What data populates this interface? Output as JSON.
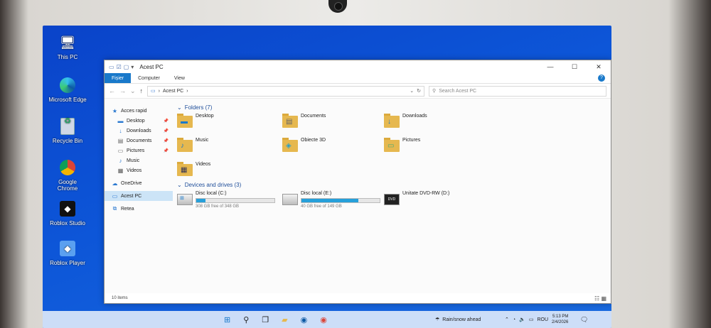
{
  "desktop": {
    "icons": [
      {
        "label": "This PC",
        "icon": "monitor-icon"
      },
      {
        "label": "Microsoft Edge",
        "icon": "edge-icon"
      },
      {
        "label": "Recycle Bin",
        "icon": "recycle-bin-icon"
      },
      {
        "label": "Google Chrome",
        "icon": "chrome-icon"
      },
      {
        "label": "Roblox Studio",
        "icon": "roblox-studio-icon"
      },
      {
        "label": "Roblox Player",
        "icon": "roblox-player-icon"
      }
    ]
  },
  "window": {
    "title": "Acest PC",
    "ribbon_tabs": [
      "Fișier",
      "Computer",
      "View"
    ],
    "address": {
      "path_root": "Acest PC",
      "path_sep": "›",
      "search_placeholder": "Search Acest PC"
    },
    "sidebar": {
      "items": [
        {
          "label": "Acces rapid",
          "icon": "star-icon",
          "pinned": false
        },
        {
          "label": "Desktop",
          "icon": "desktop-folder-icon",
          "pinned": true
        },
        {
          "label": "Downloads",
          "icon": "download-icon",
          "pinned": true
        },
        {
          "label": "Documents",
          "icon": "documents-icon",
          "pinned": true
        },
        {
          "label": "Pictures",
          "icon": "pictures-icon",
          "pinned": true
        },
        {
          "label": "Music",
          "icon": "music-icon",
          "pinned": false
        },
        {
          "label": "Videos",
          "icon": "videos-icon",
          "pinned": false
        },
        {
          "label": "OneDrive",
          "icon": "cloud-icon",
          "pinned": false
        },
        {
          "label": "Acest PC",
          "icon": "monitor-icon",
          "pinned": false
        },
        {
          "label": "Retea",
          "icon": "network-icon",
          "pinned": false
        }
      ]
    },
    "folders_group": "Folders (7)",
    "folders": [
      {
        "label": "Desktop",
        "mark": "▬"
      },
      {
        "label": "Documents",
        "mark": "▤"
      },
      {
        "label": "Downloads",
        "mark": "↓"
      },
      {
        "label": "Music",
        "mark": "♪"
      },
      {
        "label": "Obiecte 3D",
        "mark": "◈"
      },
      {
        "label": "Pictures",
        "mark": "▭"
      },
      {
        "label": "Videos",
        "mark": "▦"
      }
    ],
    "drives_group": "Devices and drives (3)",
    "drives": [
      {
        "label": "Disc local (C:)",
        "free": "308 GB free of 348 GB",
        "used_fraction": 0.115,
        "kind": "windows"
      },
      {
        "label": "Disc local (E:)",
        "free": "40 GB free of 149 GB",
        "used_fraction": 0.73,
        "kind": "hdd"
      },
      {
        "label": "Unitate DVD-RW (D:)",
        "free": "",
        "used_fraction": null,
        "kind": "dvd"
      }
    ],
    "status": "10 items"
  },
  "taskbar": {
    "weather": "Rain/snow ahead",
    "lang": "ROU",
    "time": "5:13 PM",
    "date": "2/4/2026"
  }
}
